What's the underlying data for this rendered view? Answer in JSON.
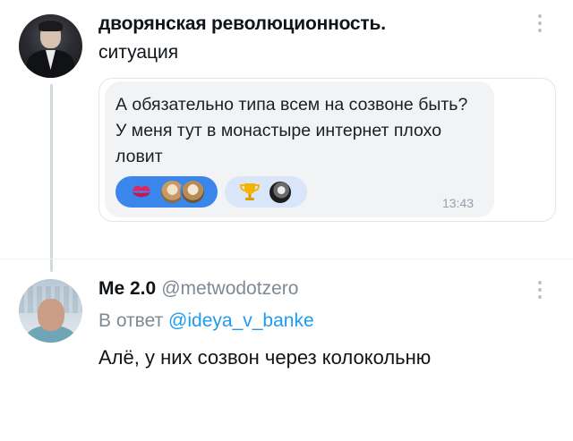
{
  "tweet1": {
    "author_name": "дворянская революционность.",
    "text": "ситуация",
    "embedded_message": {
      "text": "А обязательно типа всем на созвоне быть? У меня тут в монастыре интернет плохо ловит",
      "time": "13:43",
      "reactions": [
        {
          "icon": "kiss-mark-icon",
          "selected": true,
          "users": 2
        },
        {
          "icon": "trophy-icon",
          "selected": false,
          "users": 1
        }
      ]
    }
  },
  "tweet2": {
    "author_name": "Me 2.0",
    "handle": "@metwodotzero",
    "reply_prefix": "В ответ",
    "reply_to": "@ideya_v_banke",
    "text": "Алё, у них созвон через колокольню"
  },
  "colors": {
    "accent": "#1d9bf0",
    "reaction_selected": "#3b86ea",
    "reaction_unselected": "#d9e6fa",
    "secondary_text": "#7f8a94"
  }
}
